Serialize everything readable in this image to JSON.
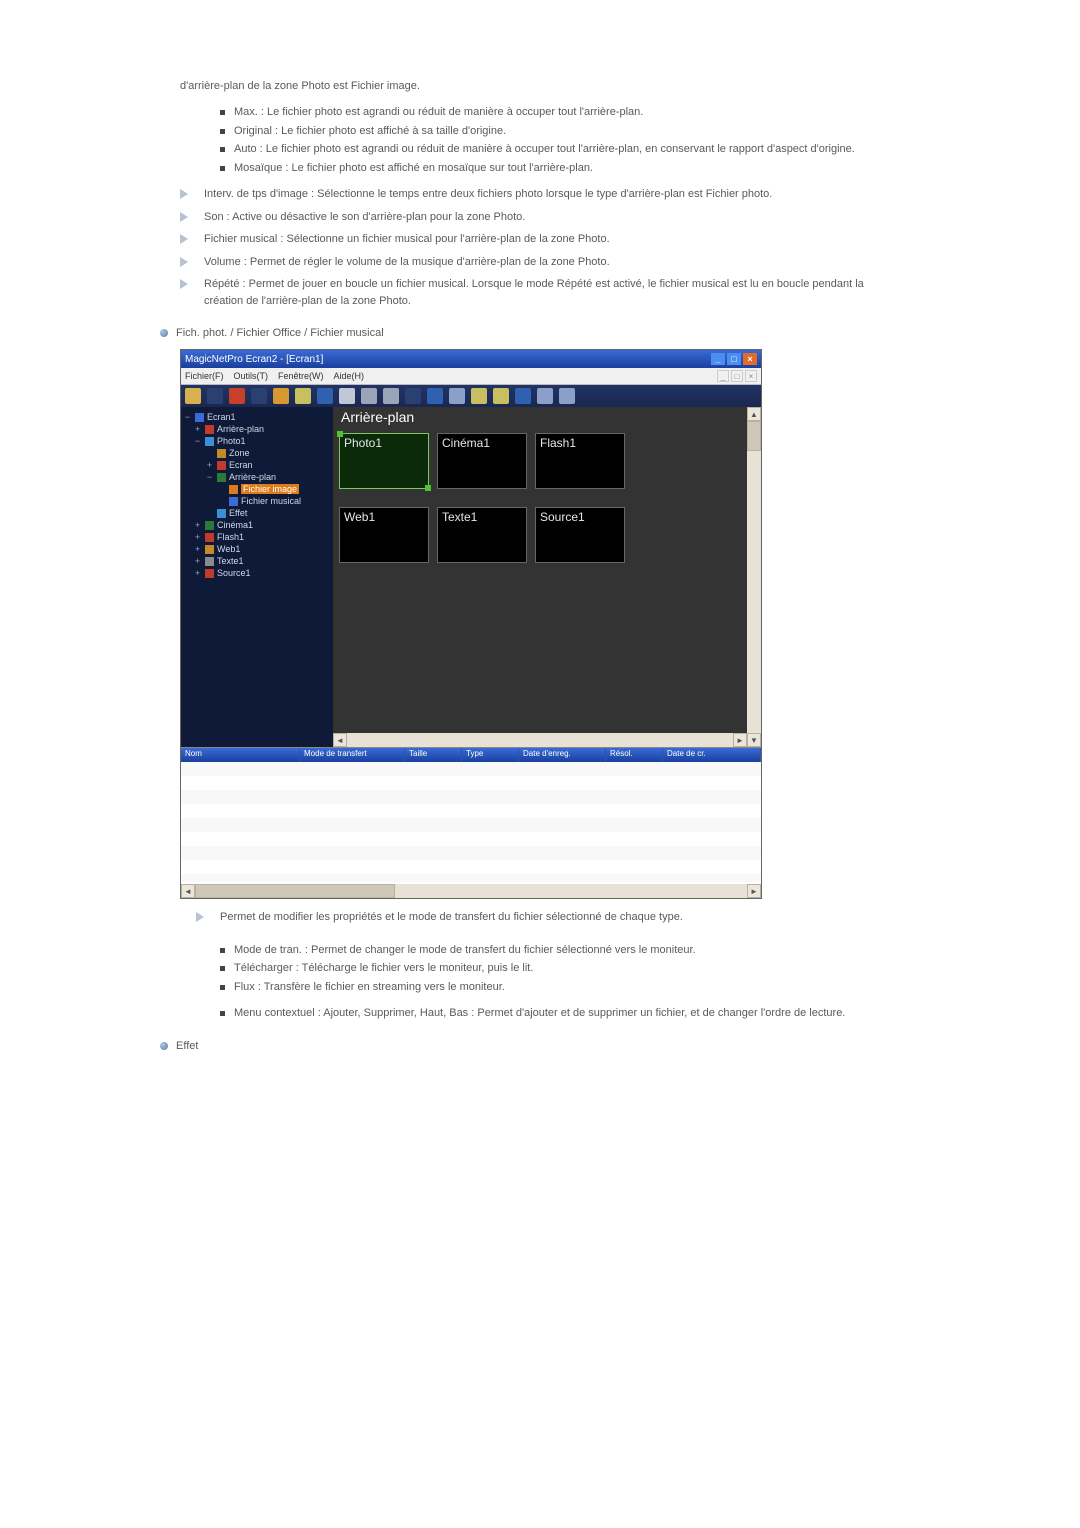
{
  "intro": "d'arrière-plan de la zone Photo est Fichier image.",
  "bg_mode_list": [
    "Max. : Le fichier photo est agrandi ou réduit de manière à occuper tout l'arrière-plan.",
    "Original : Le fichier photo est affiché à sa taille d'origine.",
    "Auto : Le fichier photo est agrandi ou réduit de manière à occuper tout l'arrière-plan, en conservant le rapport d'aspect d'origine.",
    "Mosaïque : Le fichier photo est affiché en mosaïque sur tout l'arrière-plan."
  ],
  "arrow_list1": [
    "Interv. de tps d'image : Sélectionne le temps entre deux fichiers photo lorsque le type d'arrière-plan est Fichier photo.",
    "Son : Active ou désactive le son d'arrière-plan pour la zone Photo.",
    "Fichier musical : Sélectionne un fichier musical pour l'arrière-plan de la zone Photo.",
    "Volume : Permet de régler le volume de la musique d'arrière-plan de la zone Photo.",
    "Répété : Permet de jouer en boucle un fichier musical. Lorsque le mode Répété est activé, le fichier musical est lu en boucle pendant la création de l'arrière-plan de la zone Photo."
  ],
  "sub1": "Fich. phot. / Fichier Office / Fichier musical",
  "screenshot": {
    "title": "MagicNetPro Ecran2 - [Ecran1]",
    "menus": [
      "Fichier(F)",
      "Outils(T)",
      "Fenêtre(W)",
      "Aide(H)"
    ],
    "tree": {
      "root": "Ecran1",
      "items": [
        "Arrière-plan",
        "Photo1",
        "Zone",
        "Ecran",
        "Arrière-plan",
        "Fichier image",
        "Fichier musical",
        "Effet",
        "Cinéma1",
        "Flash1",
        "Web1",
        "Texte1",
        "Source1"
      ],
      "selected": "Fichier image"
    },
    "bg_header": "Arrière-plan",
    "thumbs_row1": [
      "Photo1",
      "Cinéma1",
      "Flash1"
    ],
    "thumbs_row2": [
      "Web1",
      "Texte1",
      "Source1"
    ],
    "grid_cols": [
      "Nom",
      "Mode de transfert",
      "Taille",
      "Type",
      "Date d'enreg.",
      "Résol.",
      "Date de cr."
    ]
  },
  "arrow_list2": [
    "Permet de modifier les propriétés et le mode de transfert du fichier sélectionné de chaque type."
  ],
  "sub_bullets2a": [
    "Mode de tran. : Permet de changer le mode de transfert du fichier sélectionné vers le moniteur.",
    "Télécharger : Télécharge le fichier vers le moniteur, puis le lit.",
    "Flux : Transfère le fichier en streaming vers le moniteur."
  ],
  "sub_bullets2b": [
    "Menu contextuel : Ajouter, Supprimer, Haut, Bas : Permet d'ajouter et de supprimer un fichier, et de changer l'ordre de lecture."
  ],
  "sub2": "Effet",
  "toolbar_colors": [
    "#d8b050",
    "#2a4070",
    "#c8402a",
    "#2a4070",
    "#d89830",
    "#c8c060",
    "#3060b0",
    "#c0c8d8",
    "#9aa6b8",
    "#9aa6b8",
    "#2a4070",
    "#3060b0",
    "#8aa0c8",
    "#c8c060",
    "#c8c060",
    "#3060b0",
    "#8aa0c8",
    "#8aa0c8"
  ],
  "tree_icon_colors": {
    "screen": "#3a6bd6",
    "bg": "#c23a2a",
    "photo": "#3a8fd6",
    "zone": "#c28b2a",
    "ecran": "#c23a2a",
    "bg2": "#2a7a3a",
    "fimg": "#dd7a1a",
    "fmus": "#3a6bd6",
    "effet": "#3a8fd6",
    "cinema": "#2a7a3a",
    "flash": "#c23a2a",
    "web": "#c28b2a",
    "texte": "#8a8a8a",
    "source": "#c23a2a"
  }
}
